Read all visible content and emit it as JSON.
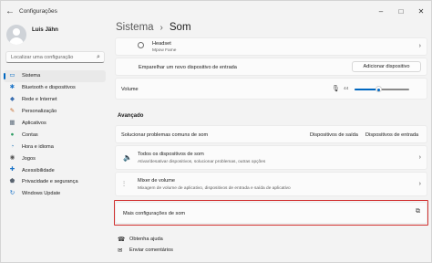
{
  "window": {
    "title": "Configurações"
  },
  "user": {
    "name": "Luis Jähn"
  },
  "search": {
    "placeholder": "Localizar uma configuração"
  },
  "nav": [
    {
      "label": "Sistema",
      "icon": "monitor-icon",
      "glyph": "▭",
      "color": "#0067c0",
      "active": true
    },
    {
      "label": "Bluetooth e dispositivos",
      "icon": "bluetooth-icon",
      "glyph": "✱",
      "color": "#1a73c8"
    },
    {
      "label": "Rede e Internet",
      "icon": "wifi-icon",
      "glyph": "◆",
      "color": "#3b6fb0"
    },
    {
      "label": "Personalização",
      "icon": "brush-icon",
      "glyph": "✎",
      "color": "#c56a2b"
    },
    {
      "label": "Aplicativos",
      "icon": "apps-icon",
      "glyph": "▦",
      "color": "#5c6b7a"
    },
    {
      "label": "Contas",
      "icon": "person-icon",
      "glyph": "●",
      "color": "#2e9d63"
    },
    {
      "label": "Hora e idioma",
      "icon": "globe-clock-icon",
      "glyph": "◔",
      "color": "#2a7ab9"
    },
    {
      "label": "Jogos",
      "icon": "gamepad-icon",
      "glyph": "◉",
      "color": "#5a5a5a"
    },
    {
      "label": "Acessibilidade",
      "icon": "accessibility-icon",
      "glyph": "✚",
      "color": "#1a73c8"
    },
    {
      "label": "Privacidade e segurança",
      "icon": "shield-icon",
      "glyph": "⬟",
      "color": "#5a6470"
    },
    {
      "label": "Windows Update",
      "icon": "refresh-icon",
      "glyph": "↻",
      "color": "#1a73c8"
    }
  ],
  "breadcrumb": {
    "parent": "Sistema",
    "separator": "›",
    "current": "Som"
  },
  "device": {
    "name": "Headset",
    "subtitle": "Mpow Fame"
  },
  "pair": {
    "label": "Emparelhar um novo dispositivo de entrada",
    "button": "Adicionar dispositivo"
  },
  "volume": {
    "label": "Volume",
    "value": "44",
    "level": 0.44
  },
  "advanced": {
    "title": "Avançado"
  },
  "troubleshoot": {
    "label": "Solucionar problemas comuns de som",
    "output": "Dispositivos de saída",
    "input": "Dispositivos de entrada"
  },
  "all_devices": {
    "title": "Todos os dispositivos de som",
    "subtitle": "Ativar/desativar dispositivos, solucionar problemas, outras opções"
  },
  "mixer": {
    "title": "Mixer de volume",
    "subtitle": "Mixagem de volume de aplicativo, dispositivos de entrada e saída de aplicativo"
  },
  "more": {
    "label": "Mais configurações de som"
  },
  "footer": {
    "help": "Obtenha ajuda",
    "feedback": "Enviar comentários"
  },
  "colors": {
    "accent": "#0067c0",
    "highlight": "#d1302f"
  }
}
